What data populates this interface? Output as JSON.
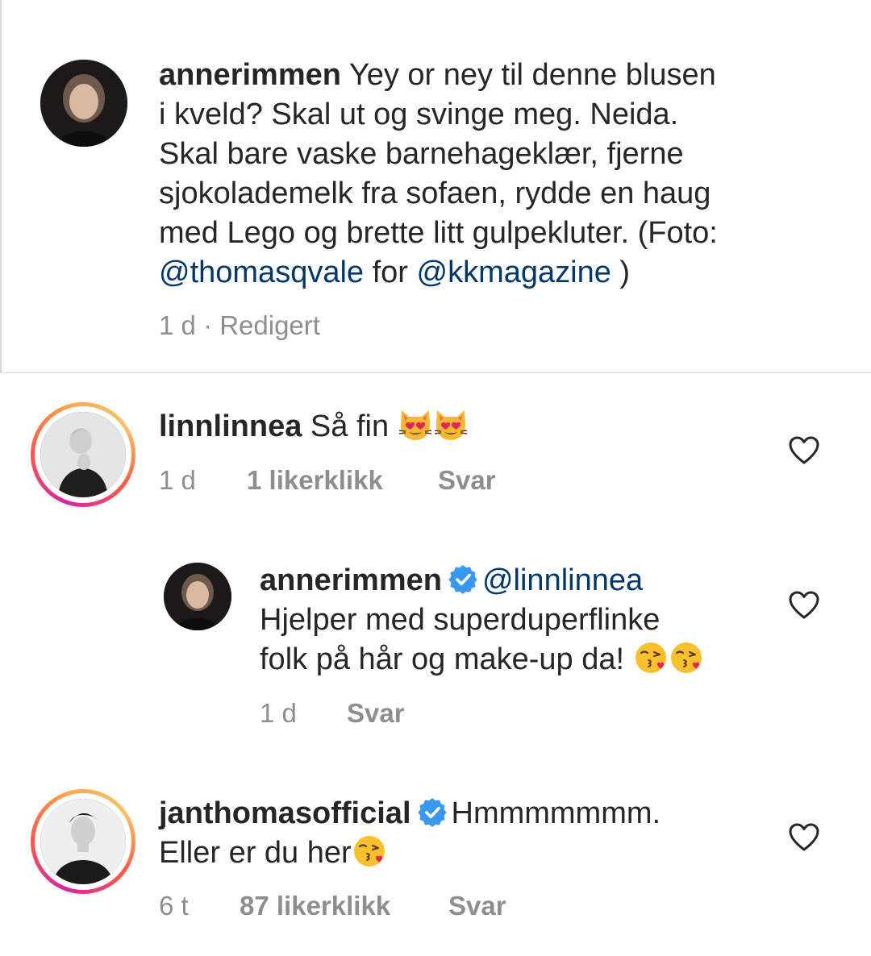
{
  "post": {
    "username": "annerimmen",
    "lines": [
      " Yey or ney til denne blusen",
      "i kveld?  Skal ut og svinge meg. Neida.",
      "Skal bare vaske barnehageklær, fjerne",
      "sjokolademelk fra sofaen, rydde en haug",
      "med Lego og brette litt gulpekluter. (Foto:"
    ],
    "mention1": "@thomasqvale",
    "middle": " for ",
    "mention2": "@kkmagazine",
    "tail": " )",
    "meta": "1 d · Redigert"
  },
  "comments": [
    {
      "username": "linnlinnea",
      "text": " Så fin ",
      "emoji": [
        "heart-eyes-cat-emoji",
        "heart-eyes-cat-emoji"
      ],
      "time": "1 d",
      "likes": "1 likerklikk",
      "reply": "Svar"
    },
    {
      "username": "annerimmen",
      "mention": "@linnlinnea",
      "line1": "Hjelper med superduperflinke",
      "line2": "folk på hår og make-up da! ",
      "emoji": [
        "kissing-heart-emoji",
        "kissing-heart-emoji"
      ],
      "time": "1 d",
      "reply": "Svar"
    },
    {
      "username": "janthomasofficial",
      "text": "Hmmmmmmm.",
      "line2": "Eller er du her",
      "emoji": [
        "kissing-heart-emoji"
      ],
      "time": "6 t",
      "likes": "87 likerklikk",
      "reply": "Svar"
    }
  ],
  "colors": {
    "mention": "#00376b",
    "verified": "#3897f0",
    "meta": "#8e8e8e",
    "text": "#262626"
  }
}
